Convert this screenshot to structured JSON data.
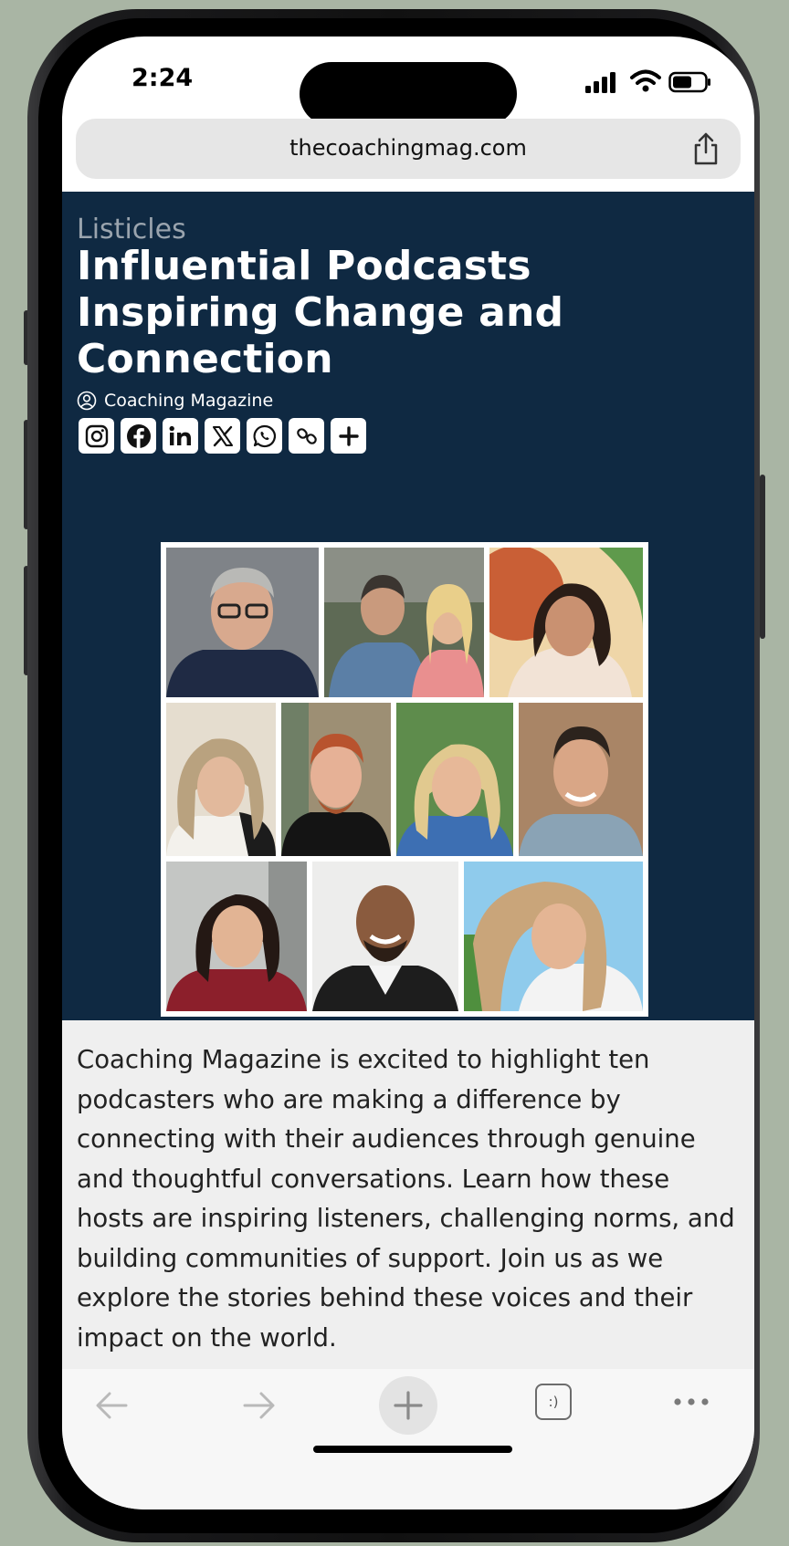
{
  "status_bar": {
    "time": "2:24"
  },
  "browser": {
    "url": "thecoachingmag.com"
  },
  "article": {
    "category": "Listicles",
    "title": "Influential Podcasts Inspiring Change and Connection",
    "author": "Coaching Magazine",
    "intro": "Coaching Magazine is excited to highlight ten podcasters who are making a difference by connecting with their audiences through genuine and thoughtful conversations. Learn how these hosts are inspiring listeners, challenging norms, and building communities of support. Join us as we explore the stories behind these voices and their impact on the world."
  },
  "share_icons": [
    "instagram-icon",
    "facebook-icon",
    "linkedin-icon",
    "x-icon",
    "whatsapp-icon",
    "copy-link-icon",
    "more-plus-icon"
  ],
  "collage": {
    "tile_count": 10
  },
  "toolbar": {
    "tabs_label": ":)"
  },
  "colors": {
    "hero_background": "#0f2942",
    "background": "#a9b5a4"
  }
}
